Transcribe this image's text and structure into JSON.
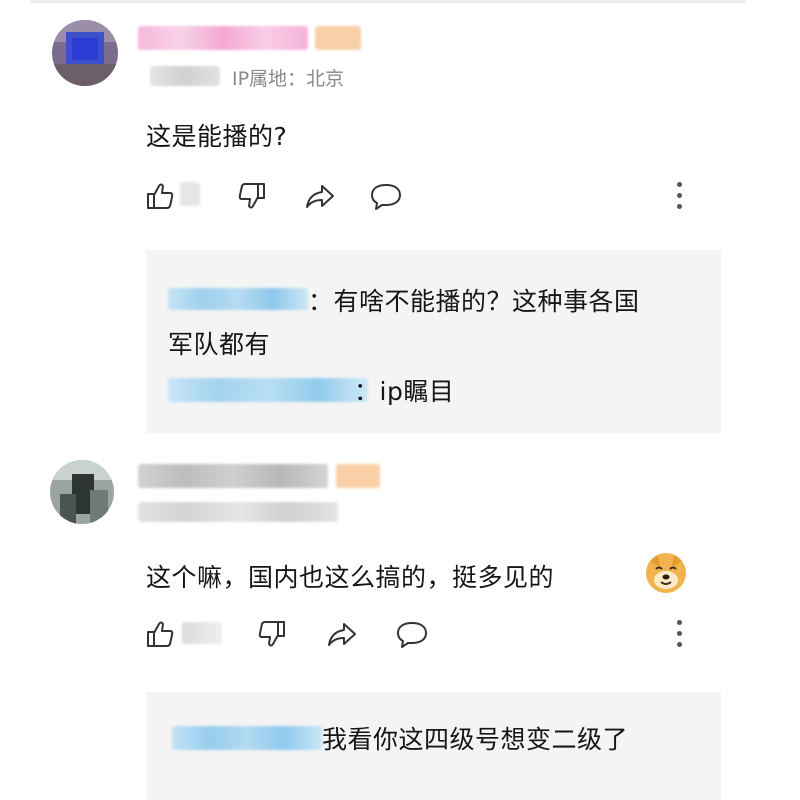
{
  "comments": [
    {
      "ip_label": "IP属地：北京",
      "text": "这是能播的?",
      "actions": {
        "like_icon": "thumbs-up-icon",
        "dislike_icon": "thumbs-down-icon",
        "share_icon": "share-arrow-icon",
        "reply_icon": "comment-bubble-icon",
        "more_icon": "more-vertical-icon"
      },
      "replies": [
        {
          "text_line1": "：有啥不能播的？这种事各国",
          "text_line2": "军队都有"
        },
        {
          "text_line1": "：ip瞩目"
        }
      ]
    },
    {
      "text": "这个嘛，国内也这么搞的，挺多见的",
      "emoji": "doge-emoji-icon",
      "actions": {
        "like_icon": "thumbs-up-icon",
        "dislike_icon": "thumbs-down-icon",
        "share_icon": "share-arrow-icon",
        "reply_icon": "comment-bubble-icon",
        "more_icon": "more-vertical-icon"
      },
      "replies": [
        {
          "text_line1": "我看你这四级号想变二级了"
        }
      ]
    }
  ],
  "colors": {
    "reply_bg": "#f4f4f4",
    "meta_text": "#8a8a8a",
    "icon_stroke": "#333333",
    "username_blur_pink": "#f6b8dc",
    "badge_blur_orange": "#f9cfa8",
    "reply_name_blur_blue": "#9dd0ee"
  }
}
